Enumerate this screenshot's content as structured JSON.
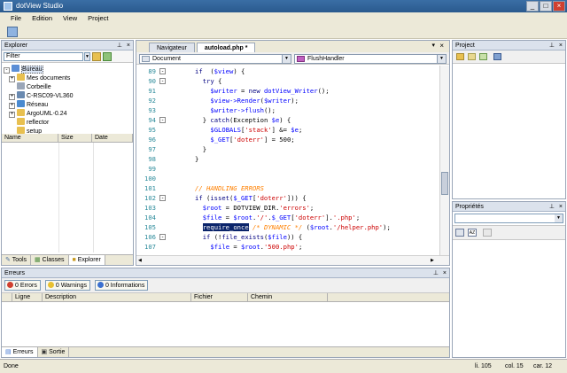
{
  "app": {
    "title": "dotView Studio"
  },
  "menu": [
    "File",
    "Edition",
    "View",
    "Project"
  ],
  "explorer": {
    "title": "Explorer",
    "filter_label": "Filter",
    "tree": [
      {
        "label": "Bureau",
        "level": 0,
        "expander": "-",
        "icon_color": "#5b8ed6",
        "selected": true
      },
      {
        "label": "Mes documents",
        "level": 1,
        "expander": "+",
        "icon_color": "#e8c050"
      },
      {
        "label": "Corbeille",
        "level": 1,
        "expander": "",
        "icon_color": "#9aa6b8"
      },
      {
        "label": "C-RSC09-VL360",
        "level": 1,
        "expander": "+",
        "icon_color": "#6a8ab0"
      },
      {
        "label": "Réseau",
        "level": 1,
        "expander": "+",
        "icon_color": "#4a8ad0"
      },
      {
        "label": "ArgoUML-0.24",
        "level": 1,
        "expander": "+",
        "icon_color": "#e8c050"
      },
      {
        "label": "reflector",
        "level": 1,
        "expander": "",
        "icon_color": "#e8c050"
      },
      {
        "label": "setup",
        "level": 1,
        "expander": "",
        "icon_color": "#e8c050"
      }
    ],
    "columns": [
      "Name",
      "Size",
      "Date"
    ],
    "tabs": [
      "Tools",
      "Classes",
      "Explorer"
    ]
  },
  "editor": {
    "tabs": [
      "Navigateur",
      "autoload.php *"
    ],
    "left_select": "Document",
    "right_select": "FlushHandler",
    "lines": [
      {
        "n": "89",
        "fold": "-",
        "indent": 6,
        "parts": [
          [
            "kw",
            "if"
          ],
          [
            "",
            "  ("
          ],
          [
            "var",
            "$view"
          ],
          [
            "",
            ") {"
          ]
        ]
      },
      {
        "n": "90",
        "fold": "-",
        "indent": 8,
        "parts": [
          [
            "kw",
            "try"
          ],
          [
            "",
            " {"
          ]
        ]
      },
      {
        "n": "91",
        "fold": "",
        "indent": 10,
        "parts": [
          [
            "var",
            "$writer"
          ],
          [
            "",
            " = "
          ],
          [
            "kw",
            "new"
          ],
          [
            "var",
            " dotView_Writer"
          ],
          [
            "",
            "();"
          ]
        ]
      },
      {
        "n": "92",
        "fold": "",
        "indent": 10,
        "parts": [
          [
            "var",
            "$view->Render"
          ],
          [
            "",
            "("
          ],
          [
            "var",
            "$writer"
          ],
          [
            "",
            ");"
          ]
        ]
      },
      {
        "n": "93",
        "fold": "",
        "indent": 10,
        "parts": [
          [
            "var",
            "$writer->flush"
          ],
          [
            "",
            "();"
          ]
        ]
      },
      {
        "n": "94",
        "fold": "-",
        "indent": 8,
        "parts": [
          [
            "",
            "} "
          ],
          [
            "kw",
            "catch"
          ],
          [
            "",
            "(Exception "
          ],
          [
            "var",
            "$e"
          ],
          [
            "",
            ") {"
          ]
        ]
      },
      {
        "n": "95",
        "fold": "",
        "indent": 10,
        "parts": [
          [
            "var",
            "$GLOBALS"
          ],
          [
            "",
            "["
          ],
          [
            "str",
            "'stack'"
          ],
          [
            "",
            "] &= "
          ],
          [
            "var",
            "$e"
          ],
          [
            "",
            ";"
          ]
        ]
      },
      {
        "n": "96",
        "fold": "",
        "indent": 10,
        "parts": [
          [
            "var",
            "$_GET"
          ],
          [
            "",
            "["
          ],
          [
            "str",
            "'doterr'"
          ],
          [
            "",
            "] = 500;"
          ]
        ]
      },
      {
        "n": "97",
        "fold": "",
        "indent": 8,
        "parts": [
          [
            "",
            "}"
          ]
        ]
      },
      {
        "n": "98",
        "fold": "",
        "indent": 6,
        "parts": [
          [
            "",
            "}"
          ]
        ]
      },
      {
        "n": "99",
        "fold": "",
        "indent": 0,
        "parts": []
      },
      {
        "n": "100",
        "fold": "",
        "indent": 0,
        "parts": []
      },
      {
        "n": "101",
        "fold": "",
        "indent": 6,
        "parts": [
          [
            "cm",
            "// HANDLING ERRORS"
          ]
        ]
      },
      {
        "n": "102",
        "fold": "-",
        "indent": 6,
        "parts": [
          [
            "kw",
            "if"
          ],
          [
            "",
            " ("
          ],
          [
            "kw",
            "isset"
          ],
          [
            "",
            "("
          ],
          [
            "var",
            "$_GET"
          ],
          [
            "",
            "["
          ],
          [
            "str",
            "'doterr'"
          ],
          [
            "",
            "])) {"
          ]
        ]
      },
      {
        "n": "103",
        "fold": "",
        "indent": 8,
        "parts": [
          [
            "var",
            "$root"
          ],
          [
            "",
            " = DOTVIEW_DIR."
          ],
          [
            "str",
            "'errors'"
          ],
          [
            "",
            ";"
          ]
        ]
      },
      {
        "n": "104",
        "fold": "",
        "indent": 8,
        "parts": [
          [
            "var",
            "$file"
          ],
          [
            "",
            " = "
          ],
          [
            "var",
            "$root"
          ],
          [
            "",
            "."
          ],
          [
            "str",
            "'/'"
          ],
          [
            "",
            "."
          ],
          [
            "var",
            "$_GET"
          ],
          [
            "",
            "["
          ],
          [
            "str",
            "'doterr'"
          ],
          [
            "",
            "]."
          ],
          [
            "str",
            "'.php'"
          ],
          [
            "",
            ";"
          ]
        ]
      },
      {
        "n": "105",
        "fold": "",
        "indent": 8,
        "parts": [
          [
            "hl",
            "require_once"
          ],
          [
            "cm",
            " /* DYNAMIC */"
          ],
          [
            "",
            " ("
          ],
          [
            "var",
            "$root"
          ],
          [
            "",
            "."
          ],
          [
            "str",
            "'/helper.php'"
          ],
          [
            "",
            ");"
          ]
        ]
      },
      {
        "n": "106",
        "fold": "-",
        "indent": 8,
        "parts": [
          [
            "kw",
            "if"
          ],
          [
            "",
            " (!"
          ],
          [
            "kw",
            "file_exists"
          ],
          [
            "",
            "("
          ],
          [
            "var",
            "$file"
          ],
          [
            "",
            ")) {"
          ]
        ]
      },
      {
        "n": "107",
        "fold": "",
        "indent": 10,
        "parts": [
          [
            "var",
            "$file"
          ],
          [
            "",
            " = "
          ],
          [
            "var",
            "$root"
          ],
          [
            "",
            "."
          ],
          [
            "str",
            "'500.php'"
          ],
          [
            "",
            ";"
          ]
        ]
      }
    ]
  },
  "project": {
    "title": "Project"
  },
  "properties": {
    "title": "Propriétés"
  },
  "errors": {
    "title": "Erreurs",
    "filters": [
      "0 Errors",
      "0 Warnings",
      "0 Informations"
    ],
    "columns": [
      "Ligne",
      "Description",
      "Fichier",
      "Chemin"
    ],
    "tabs": [
      "Erreurs",
      "Sortie"
    ]
  },
  "status": {
    "text": "Done",
    "line": "li. 105",
    "col": "col. 15",
    "car": "car. 12"
  },
  "colors": {
    "accent": "#3a6ea5",
    "chrome": "#ece9d8",
    "panel_head": "#dbe2ec"
  }
}
